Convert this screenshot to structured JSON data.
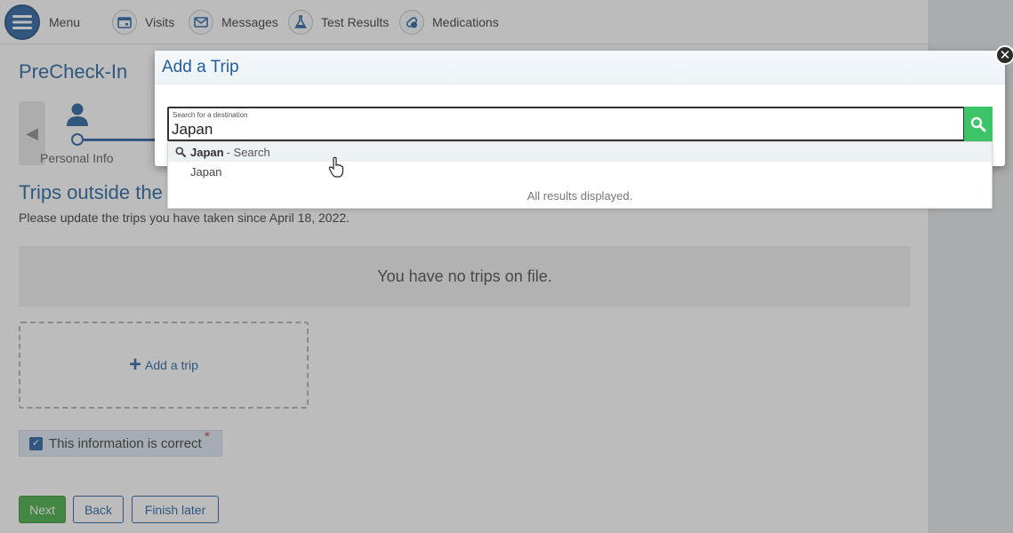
{
  "nav": {
    "menu_label": "Menu",
    "items": [
      {
        "label": "Visits",
        "icon": "calendar-icon"
      },
      {
        "label": "Messages",
        "icon": "envelope-icon"
      },
      {
        "label": "Test Results",
        "icon": "flask-icon"
      },
      {
        "label": "Medications",
        "icon": "pills-icon"
      }
    ]
  },
  "page": {
    "title": "PreCheck-In",
    "step_label": "Personal Info",
    "section_title": "Trips outside the",
    "section_subtitle": "Please update the trips you have taken since April 18, 2022.",
    "no_trips": "You have no trips on file.",
    "add_trip": "Add a trip",
    "confirm_label": "This information is correct",
    "required_mark": "*",
    "buttons": {
      "next": "Next",
      "back": "Back",
      "finish_later": "Finish later"
    }
  },
  "modal": {
    "title": "Add a Trip",
    "search_label": "Search for a destination",
    "search_value": "Japan",
    "dropdown": {
      "first_bold": "Japan",
      "first_suffix": "- Search",
      "second": "Japan",
      "status": "All results displayed."
    }
  },
  "colors": {
    "brand": "#1f5d9c",
    "success": "#3ea83e",
    "search_button": "#3ec468"
  }
}
